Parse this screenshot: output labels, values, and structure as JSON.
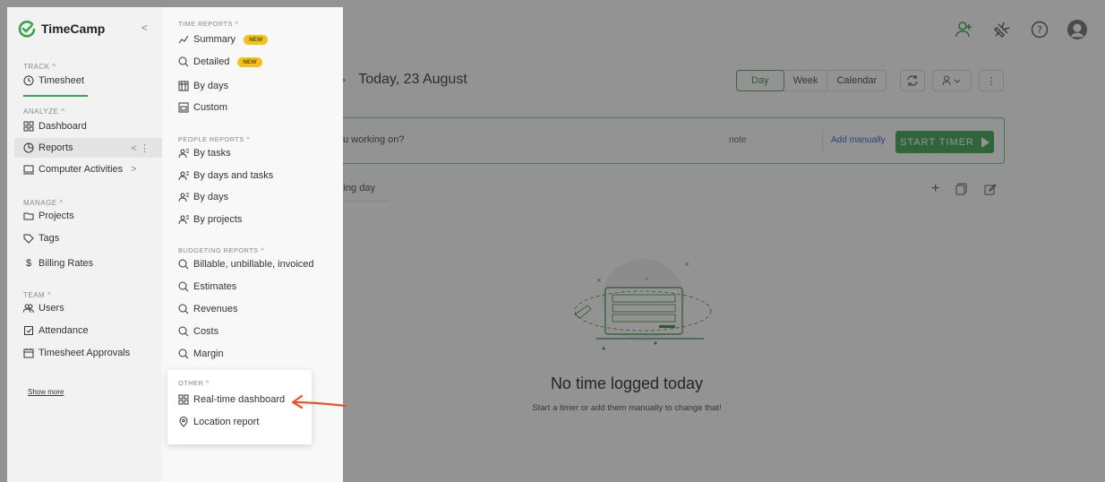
{
  "app": {
    "logo_text": "TimeCamp",
    "collapse_glyph": "<",
    "brand_color": "#38a34a",
    "accent_orange": "#e9552b"
  },
  "sidebar": {
    "sections": [
      {
        "label": "TRACK ^",
        "items": [
          {
            "label": "Timesheet",
            "icon": "clock-icon",
            "active_underline": true
          }
        ]
      },
      {
        "label": "ANALYZE ^",
        "items": [
          {
            "label": "Dashboard",
            "icon": "dashboard-icon"
          },
          {
            "label": "Reports",
            "icon": "reports-icon",
            "active": true,
            "suffix": "< ⋮"
          },
          {
            "label": "Computer Activities",
            "icon": "computer-icon",
            "suffix": ">"
          }
        ]
      },
      {
        "label": "MANAGE ^",
        "items": [
          {
            "label": "Projects",
            "icon": "folder-icon"
          },
          {
            "label": "Tags",
            "icon": "tag-icon"
          },
          {
            "label": "Billing Rates",
            "icon": "dollar-icon"
          }
        ]
      },
      {
        "label": "TEAM ^",
        "items": [
          {
            "label": "Users",
            "icon": "users-icon"
          },
          {
            "label": "Attendance",
            "icon": "attendance-icon"
          },
          {
            "label": "Timesheet Approvals",
            "icon": "approvals-icon"
          }
        ]
      }
    ],
    "show_more": "Show more"
  },
  "reports_menu": {
    "time_reports": {
      "label": "TIME REPORTS ^",
      "items": [
        "Summary",
        "Detailed",
        "By days",
        "Custom"
      ],
      "new_badge": "NEW"
    },
    "people_reports": {
      "label": "PEOPLE REPORTS ^",
      "items": [
        "By tasks",
        "By days and tasks",
        "By days",
        "By projects"
      ]
    },
    "budgeting_reports": {
      "label": "BUDGETING REPORTS ^",
      "items": [
        "Billable, unbillable, invoiced",
        "Estimates",
        "Revenues",
        "Costs",
        "Margin"
      ]
    },
    "other": {
      "label": "OTHER ^",
      "items": [
        "Real-time dashboard",
        "Location report"
      ]
    }
  },
  "main": {
    "date_label": "Today, 23 August",
    "view_tabs": [
      "Day",
      "Week",
      "Calendar"
    ],
    "timer": {
      "question": "u working on?",
      "note": "note",
      "add_manually": "Add manually",
      "start": "START TIMER"
    },
    "working_day": "king day",
    "empty_title": "No time logged today",
    "empty_sub": "Start a timer or add them manually to change that!"
  },
  "topbar": {
    "icons": [
      "add-user-icon",
      "plugin-icon",
      "help-icon",
      "avatar-icon"
    ]
  }
}
